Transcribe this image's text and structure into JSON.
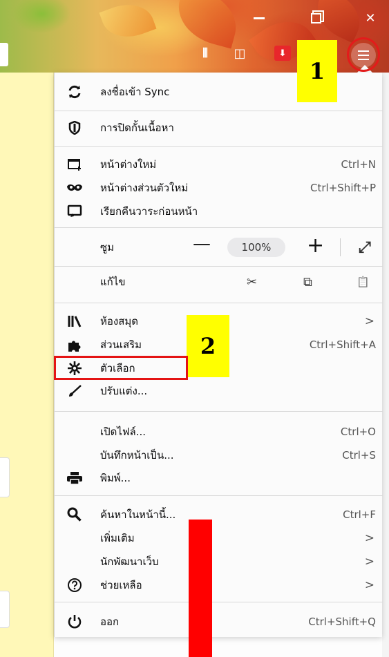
{
  "titlebar": {
    "minimize_icon": "minimize-icon",
    "restore_icon": "restore-icon",
    "close_glyph": "✕"
  },
  "toolbar": {
    "library_glyph": "⫴",
    "sidebar_glyph": "◫",
    "download_glyph": "⬇"
  },
  "menu": {
    "sync": {
      "icon": "sync-icon",
      "label": "ลงชื่อเข้า Sync"
    },
    "content_blocking": {
      "icon": "shield-icon",
      "label": "การปิดกั้นเนื้อหา"
    },
    "new_window": {
      "icon": "new-window-icon",
      "label": "หน้าต่างใหม่",
      "shortcut": "Ctrl+N"
    },
    "private_window": {
      "icon": "mask-icon",
      "label": "หน้าต่างส่วนตัวใหม่",
      "shortcut": "Ctrl+Shift+P"
    },
    "restore_session": {
      "icon": "restore-session-icon",
      "label": "เรียกคืนวาระก่อนหน้า"
    },
    "zoom": {
      "label": "ซูม",
      "minus": "—",
      "value": "100%",
      "plus": "+",
      "fullscreen_glyph": "⤢"
    },
    "edit": {
      "label": "แก้ไข",
      "cut_glyph": "✂",
      "copy_glyph": "⧉",
      "paste_glyph": "📋"
    },
    "library": {
      "icon": "library-icon",
      "label": "ห้องสมุด",
      "chevron": ">"
    },
    "addons": {
      "icon": "puzzle-icon",
      "label": "ส่วนเสริม",
      "shortcut": "Ctrl+Shift+A"
    },
    "options": {
      "icon": "gear-icon",
      "label": "ตัวเลือก"
    },
    "customize": {
      "icon": "brush-icon",
      "label": "ปรับแต่ง..."
    },
    "open_file": {
      "label": "เปิดไฟล์...",
      "shortcut": "Ctrl+O"
    },
    "save_page": {
      "label": "บันทึกหน้าเป็น...",
      "shortcut": "Ctrl+S"
    },
    "print": {
      "icon": "printer-icon",
      "label": "พิมพ์..."
    },
    "find": {
      "icon": "search-icon",
      "label": "ค้นหาในหน้านี้...",
      "shortcut": "Ctrl+F"
    },
    "more": {
      "label": "เพิ่มเติม",
      "chevron": ">"
    },
    "web_developer": {
      "label": "นักพัฒนาเว็บ",
      "chevron": ">"
    },
    "help": {
      "icon": "help-icon",
      "label": "ช่วยเหลือ",
      "chevron": ">"
    },
    "quit": {
      "icon": "power-icon",
      "label": "ออก",
      "shortcut": "Ctrl+Shift+Q"
    }
  },
  "annotations": {
    "step1": "1",
    "step2": "2"
  },
  "colors": {
    "highlight_red": "#e41414",
    "note_yellow": "#ffff00"
  }
}
